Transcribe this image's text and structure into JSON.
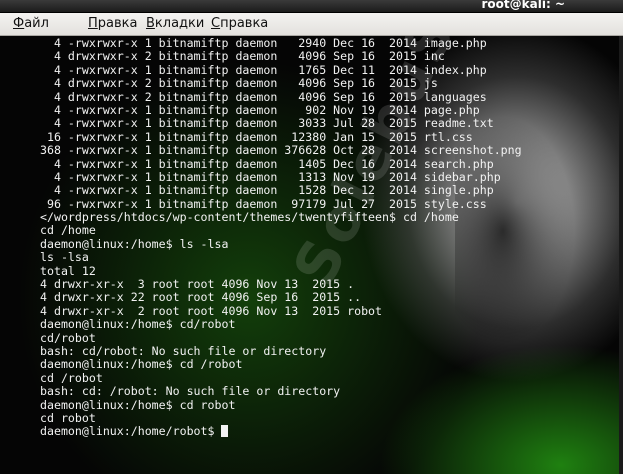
{
  "window": {
    "title": "root@kali: ~"
  },
  "menu": {
    "items": [
      "Файл",
      "Правка",
      "Вкладки",
      "Справка"
    ]
  },
  "watermark": {
    "text": "SolebuSet"
  },
  "terminal": {
    "lines": [
      "  4 -rwxrwxr-x 1 bitnamiftp daemon   2940 Dec 16  2014 image.php",
      "  4 drwxrwxr-x 2 bitnamiftp daemon   4096 Sep 16  2015 inc",
      "  4 -rwxrwxr-x 1 bitnamiftp daemon   1765 Dec 11  2014 index.php",
      "  4 drwxrwxr-x 2 bitnamiftp daemon   4096 Sep 16  2015 js",
      "  4 drwxrwxr-x 2 bitnamiftp daemon   4096 Sep 16  2015 languages",
      "  4 -rwxrwxr-x 1 bitnamiftp daemon    902 Nov 19  2014 page.php",
      "  4 -rwxrwxr-x 1 bitnamiftp daemon   3033 Jul 28  2015 readme.txt",
      " 16 -rwxrwxr-x 1 bitnamiftp daemon  12380 Jan 15  2015 rtl.css",
      "368 -rwxrwxr-x 1 bitnamiftp daemon 376628 Oct 28  2014 screenshot.png",
      "  4 -rwxrwxr-x 1 bitnamiftp daemon   1405 Dec 16  2014 search.php",
      "  4 -rwxrwxr-x 1 bitnamiftp daemon   1313 Nov 19  2014 sidebar.php",
      "  4 -rwxrwxr-x 1 bitnamiftp daemon   1528 Dec 12  2014 single.php",
      " 96 -rwxrwxr-x 1 bitnamiftp daemon  97179 Jul 27  2015 style.css",
      "</wordpress/htdocs/wp-content/themes/twentyfifteen$ cd /home",
      "cd /home",
      "daemon@linux:/home$ ls -lsa",
      "ls -lsa",
      "total 12",
      "4 drwxr-xr-x  3 root root 4096 Nov 13  2015 .",
      "4 drwxr-xr-x 22 root root 4096 Sep 16  2015 ..",
      "4 drwxr-xr-x  2 root root 4096 Nov 13  2015 robot",
      "daemon@linux:/home$ cd/robot",
      "cd/robot",
      "bash: cd/robot: No such file or directory",
      "daemon@linux:/home$ cd /robot",
      "cd /robot",
      "bash: cd: /robot: No such file or directory",
      "daemon@linux:/home$ cd robot",
      "cd robot"
    ],
    "prompt": "daemon@linux:/home/robot$ "
  }
}
